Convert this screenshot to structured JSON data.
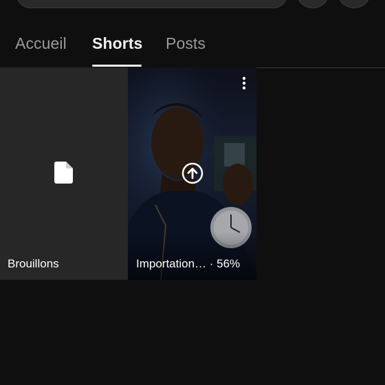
{
  "tabs": [
    {
      "label": "Accueil",
      "active": false
    },
    {
      "label": "Shorts",
      "active": true
    },
    {
      "label": "Posts",
      "active": false
    }
  ],
  "tiles": {
    "drafts": {
      "label": "Brouillons",
      "icon": "document-icon"
    },
    "upload": {
      "label": "Importation… · 56%",
      "progress_percent": 56,
      "icon": "upload-arrow-icon",
      "menu_icon": "more-vert-icon"
    }
  },
  "colors": {
    "background": "#0f0f0f",
    "tab_active": "#f1f1f1",
    "tab_inactive": "#9a9a9a",
    "tile_bg": "#272727"
  }
}
